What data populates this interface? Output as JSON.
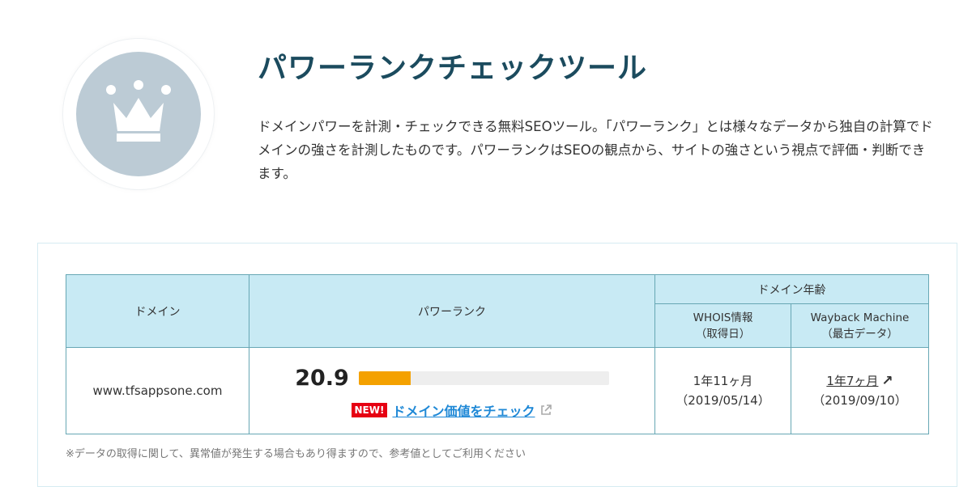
{
  "header": {
    "title": "パワーランクチェックツール",
    "description": "ドメインパワーを計測・チェックできる無料SEOツール。「パワーランク」とは様々なデータから独自の計算でドメインの強さを計測したものです。パワーランクはSEOの観点から、サイトの強さという視点で評価・判断できます。"
  },
  "logo": {
    "icon": "crown-icon",
    "bg_color": "#bccbd5"
  },
  "table": {
    "headers": {
      "domain": "ドメイン",
      "power_rank": "パワーランク",
      "domain_age": "ドメイン年齢",
      "whois": "WHOIS情報",
      "whois_sub": "（取得日）",
      "wayback": "Wayback Machine",
      "wayback_sub": "（最古データ）"
    },
    "row": {
      "domain": "www.tfsappsone.com",
      "power_rank": "20.9",
      "power_rank_fraction": 0.209,
      "new_badge": "NEW!",
      "check_link": "ドメイン価値をチェック",
      "whois_age": "1年11ヶ月",
      "whois_date": "（2019/05/14）",
      "wayback_age": "1年7ヶ月",
      "wayback_arrow": "↗",
      "wayback_date": "（2019/09/10）"
    }
  },
  "note": "※データの取得に関して、異常値が発生する場合もあり得ますので、参考値としてご利用ください",
  "colors": {
    "title": "#1b4b5e",
    "header_bg": "#c8eaf4",
    "border": "#67a7b4",
    "bar_fill": "#f4a100",
    "link": "#1e88d6",
    "badge": "#e60012"
  }
}
